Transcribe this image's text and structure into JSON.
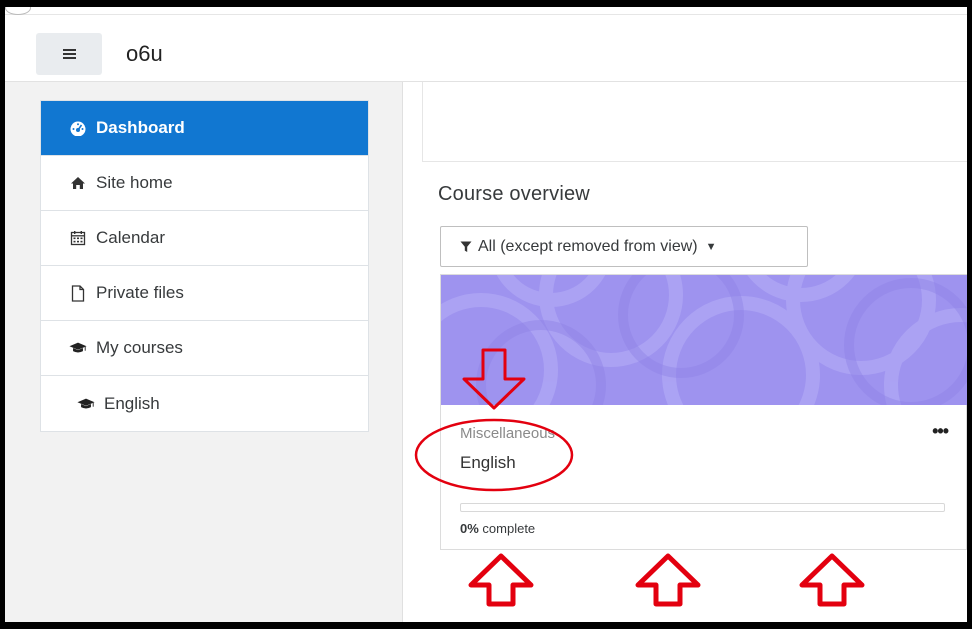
{
  "navbar": {
    "site_name": "o6u",
    "menu_icon": "hamburger-icon"
  },
  "sidebar": {
    "items": [
      {
        "label": "Dashboard",
        "icon": "dashboard-icon",
        "active": true
      },
      {
        "label": "Site home",
        "icon": "home-icon",
        "active": false
      },
      {
        "label": "Calendar",
        "icon": "calendar-icon",
        "active": false
      },
      {
        "label": "Private files",
        "icon": "file-icon",
        "active": false
      },
      {
        "label": "My courses",
        "icon": "graduation-cap-icon",
        "active": false
      },
      {
        "label": "English",
        "icon": "graduation-cap-icon",
        "active": false
      }
    ]
  },
  "main": {
    "overview_title": "Course overview",
    "filter_label": "All (except removed from view)",
    "course": {
      "category": "Miscellaneous",
      "name": "English",
      "more_label": "•••",
      "progress_percent": 0,
      "progress_value": "0%",
      "progress_suffix": " complete"
    }
  },
  "colors": {
    "accent": "#1177d1",
    "card_image": "#9e93ef",
    "annotation": "#e3000f"
  }
}
